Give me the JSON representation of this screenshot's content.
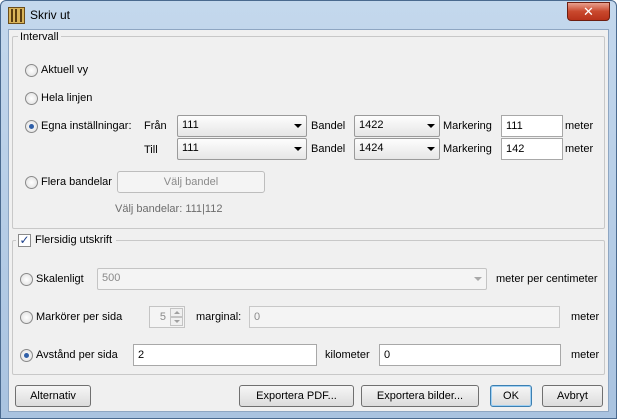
{
  "window": {
    "title": "Skriv ut",
    "close_symbol": "✕"
  },
  "intervall": {
    "group_label": "Intervall",
    "aktuell_vy": "Aktuell vy",
    "hela_linjen": "Hela linjen",
    "egna_installningar": "Egna inställningar:",
    "fran_label": "Från",
    "till_label": "Till",
    "bandel_label": "Bandel",
    "markering_label": "Markering",
    "meter_label": "meter",
    "fran_line": "111",
    "till_line": "111",
    "fran_bandel": "1422",
    "till_bandel": "1424",
    "fran_markering": "111",
    "till_markering": "142",
    "flera_bandelar": "Flera bandelar",
    "valj_bandel_button": "Välj bandel",
    "valj_bandelar_text": "Välj bandelar: 111|112",
    "selected_option": "egna_installningar"
  },
  "flersidig": {
    "checkbox_label": "Flersidig utskrift",
    "checked": true,
    "skalenligt": "Skalenligt",
    "skalenligt_value": "500",
    "skalenligt_unit": "meter per centimeter",
    "markorer_per_sida": "Markörer per sida",
    "markorer_value": "5",
    "marginal_label": "marginal:",
    "marginal_value": "0",
    "marginal_unit": "meter",
    "avstand_per_sida": "Avstånd per sida",
    "avstand_value": "2",
    "kilometer_label": "kilometer",
    "avstand_meter_value": "0",
    "avstand_meter_unit": "meter",
    "selected_option": "avstand_per_sida"
  },
  "buttons": {
    "alternativ": "Alternativ",
    "exportera_pdf": "Exportera PDF...",
    "exportera_bilder": "Exportera bilder...",
    "ok": "OK",
    "avbryt": "Avbryt"
  }
}
